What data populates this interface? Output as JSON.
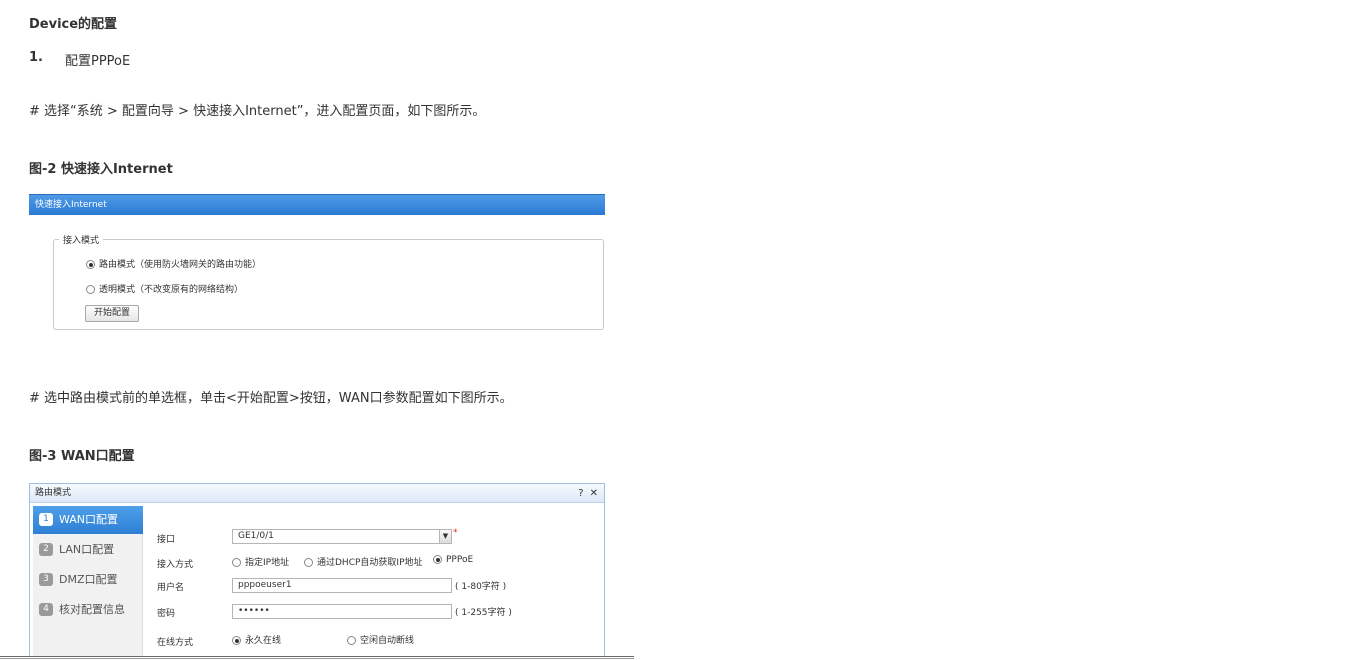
{
  "doc": {
    "section_title": "Device的配置",
    "step1_number": "1.",
    "step1_label": "配置PPPoE",
    "para1": "# 选择“系统  > 配置向导  > 快速接入Internet”，进入配置页面，如下图所示。",
    "fig2_caption": "图-2 快速接入Internet",
    "para2": "# 选中路由模式前的单选框，单击<开始配置>按钮，WAN口参数配置如下图所示。",
    "fig3_caption": "图-3 WAN口配置"
  },
  "fig2": {
    "title_bar": "快速接入Internet",
    "legend": "接入模式",
    "options": [
      {
        "label": "路由模式（使用防火墙网关的路由功能）",
        "selected": true
      },
      {
        "label": "透明模式（不改变原有的网络结构）",
        "selected": false
      }
    ],
    "start_button": "开始配置"
  },
  "fig3": {
    "title": "路由模式",
    "help": "?",
    "close": "✕",
    "steps": [
      {
        "num": "1",
        "label": "WAN口配置",
        "active": true
      },
      {
        "num": "2",
        "label": "LAN口配置",
        "active": false
      },
      {
        "num": "3",
        "label": "DMZ口配置",
        "active": false
      },
      {
        "num": "4",
        "label": "核对配置信息",
        "active": false
      }
    ],
    "form": {
      "interface_label": "接口",
      "interface_value": "GE1/0/1",
      "required_mark": "*",
      "access_label": "接入方式",
      "access_options": [
        {
          "label": "指定IP地址",
          "selected": false
        },
        {
          "label": "通过DHCP自动获取IP地址",
          "selected": false
        },
        {
          "label": "PPPoE",
          "selected": true
        }
      ],
      "username_label": "用户名",
      "username_value": "pppoeuser1",
      "username_hint": "( 1-80字符 )",
      "password_label": "密码",
      "password_value": "••••••",
      "password_hint": "( 1-255字符 )",
      "online_label": "在线方式",
      "online_options": [
        {
          "label": "永久在线",
          "selected": true
        },
        {
          "label": "空闲自动断线",
          "selected": false
        }
      ]
    }
  }
}
